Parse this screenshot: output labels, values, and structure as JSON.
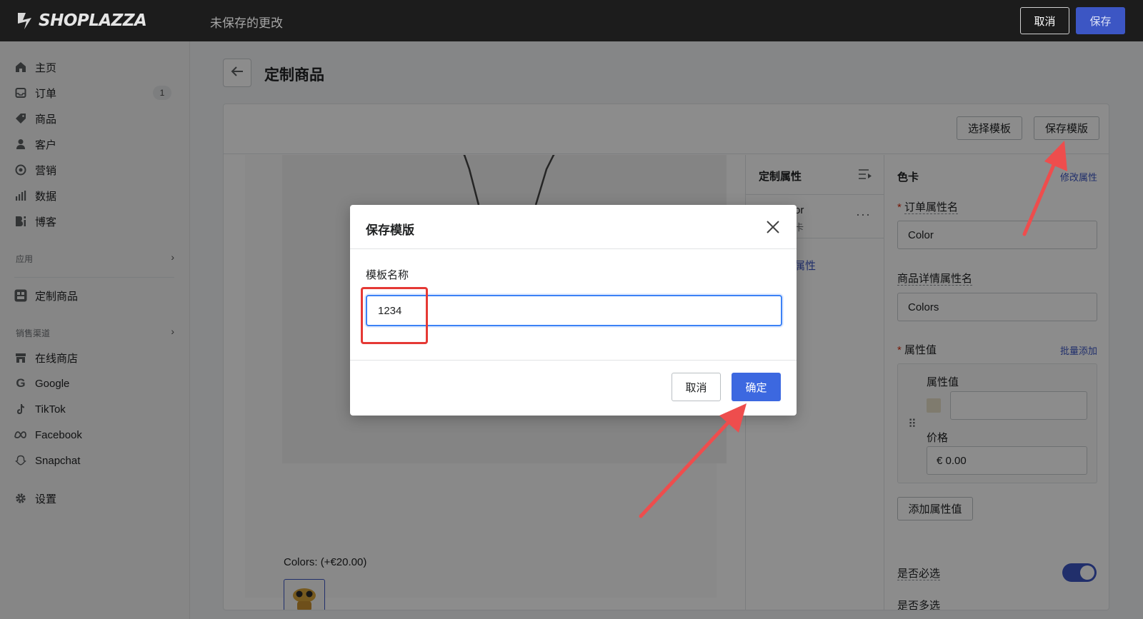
{
  "topbar": {
    "logo_text": "SHOPLAZZA",
    "status": "未保存的更改",
    "cancel_label": "取消",
    "save_label": "保存"
  },
  "sidebar": {
    "items": [
      {
        "label": "主页",
        "icon": "home-icon"
      },
      {
        "label": "订单",
        "icon": "inbox-icon",
        "badge": "1"
      },
      {
        "label": "商品",
        "icon": "tag-icon"
      },
      {
        "label": "客户",
        "icon": "person-icon"
      },
      {
        "label": "营销",
        "icon": "target-icon"
      },
      {
        "label": "数据",
        "icon": "bar-chart-icon"
      },
      {
        "label": "博客",
        "icon": "blog-icon"
      }
    ],
    "apps_label": "应用",
    "app_item": "定制商品",
    "channels_label": "销售渠道",
    "channels": [
      {
        "label": "在线商店",
        "icon": "store-icon"
      },
      {
        "label": "Google",
        "icon": "google-icon"
      },
      {
        "label": "TikTok",
        "icon": "tiktok-icon"
      },
      {
        "label": "Facebook",
        "icon": "meta-icon"
      },
      {
        "label": "Snapchat",
        "icon": "snapchat-icon"
      }
    ],
    "settings_label": "设置"
  },
  "page": {
    "title": "定制商品",
    "select_template": "选择模板",
    "save_template": "保存模版"
  },
  "preview": {
    "colors_label": "Colors:",
    "colors_price": "(+€20.00)"
  },
  "attributes": {
    "heading": "定制属性",
    "item_name_fragment": "or",
    "item_sub_fragment": "卡",
    "add_link_fragment": "属性"
  },
  "detail": {
    "heading": "色卡",
    "edit_link": "修改属性",
    "order_attr_label": "订单属性名",
    "order_attr_value": "Color",
    "detail_attr_label": "商品详情属性名",
    "detail_attr_value": "Colors",
    "values_label": "属性值",
    "bulk_add": "批量添加",
    "value_field_label": "属性值",
    "price_label": "价格",
    "price_value": "€ 0.00",
    "add_value_button": "添加属性值",
    "required_label": "是否必选",
    "multi_label": "是否多选"
  },
  "modal": {
    "title": "保存模版",
    "field_label": "模板名称",
    "field_value": "1234",
    "cancel_label": "取消",
    "confirm_label": "确定"
  },
  "colors": {
    "primary": "#3c56c4",
    "annotation": "#e53935"
  }
}
